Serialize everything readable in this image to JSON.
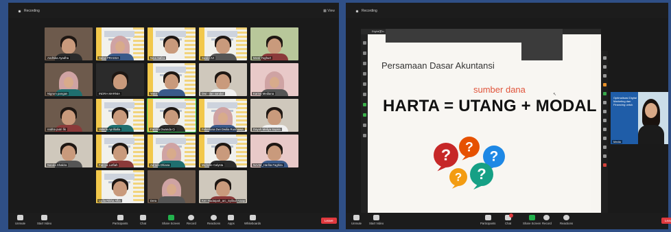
{
  "left_window": {
    "recording_label": "Recording",
    "view_label": "View",
    "participants": [
      {
        "name": "Andhika Ayadha",
        "style": "room"
      },
      {
        "name": "Salsa PRASSA",
        "style": "white"
      },
      {
        "name": "Nina Safira",
        "style": "white"
      },
      {
        "name": "Susilo Art",
        "style": "white"
      },
      {
        "name": "Mesti Yoghurt",
        "style": "green"
      },
      {
        "name": "Nigrum pangan",
        "style": "room"
      },
      {
        "name": "INDRA MARNIA",
        "style": "dark"
      },
      {
        "name": "Yana",
        "style": "white"
      },
      {
        "name": "Dwi - ilan sandal",
        "style": "wall"
      },
      {
        "name": "Karina Mediana",
        "style": "pink"
      },
      {
        "name": "nabha putri fik",
        "style": "room"
      },
      {
        "name": "Valeria Aprilliafia",
        "style": "white"
      },
      {
        "name": "Farizka Dwanda Ci",
        "style": "white"
      },
      {
        "name": "Feberiana Dwi Dwilia Rusmawa",
        "style": "white"
      },
      {
        "name": "Dayuh Meliya Sapira",
        "style": "wall"
      },
      {
        "name": "Nanda Shakira",
        "style": "wall"
      },
      {
        "name": "Fatrina Lutfiah",
        "style": "white"
      },
      {
        "name": "Adrtela Dhiana",
        "style": "white"
      },
      {
        "name": "Michelle Calysta",
        "style": "white"
      },
      {
        "name": "NAAM_Harlita Faghita",
        "style": "pink"
      },
      {
        "name": "Lydia Rikha Aflia",
        "style": "white"
      },
      {
        "name": "Dera",
        "style": "room"
      },
      {
        "name": "Ken Nadaipah_arc_Syifaul Araap",
        "style": "wall"
      }
    ],
    "toolbar": [
      {
        "label": "Unmute",
        "icon": "microphone-muted-icon"
      },
      {
        "label": "Start Video",
        "icon": "video-off-icon"
      },
      {
        "label": "Participants",
        "icon": "participants-icon",
        "count": "26"
      },
      {
        "label": "Chat",
        "icon": "chat-icon"
      },
      {
        "label": "Share Screen",
        "icon": "share-screen-icon"
      },
      {
        "label": "Record",
        "icon": "record-icon"
      },
      {
        "label": "Reactions",
        "icon": "reactions-icon"
      },
      {
        "label": "Apps",
        "icon": "apps-icon"
      },
      {
        "label": "Whiteboards",
        "icon": "whiteboard-icon"
      }
    ],
    "end_label": "Leave"
  },
  "right_window": {
    "recording_label": "Recording",
    "share_title": "Digital Fin",
    "slide": {
      "title": "Persamaan Dasar Akuntansi",
      "annotation": "sumber dana",
      "equation": "HARTA = UTANG + MODAL",
      "question_colors": [
        "#c62828",
        "#e65100",
        "#1e88e5",
        "#f39c12",
        "#16a085"
      ]
    },
    "speaker": {
      "banner_text": "Optimalisasi Digital Marketing dan Financing untuk",
      "name": "Media"
    },
    "toolbar": [
      {
        "label": "Unmute",
        "icon": "microphone-muted-icon"
      },
      {
        "label": "Start Video",
        "icon": "video-off-icon"
      },
      {
        "label": "Participants",
        "icon": "participants-icon",
        "count": "26"
      },
      {
        "label": "Chat",
        "icon": "chat-icon"
      },
      {
        "label": "Share Screen",
        "icon": "share-screen-icon"
      },
      {
        "label": "Record",
        "icon": "record-icon"
      },
      {
        "label": "Reactions",
        "icon": "reactions-icon"
      }
    ],
    "end_label": "Leave"
  },
  "colors": {
    "background": "#2f4f86",
    "window": "#1a1a1a",
    "share_green": "#22b14c",
    "end_red": "#e0393e",
    "annotation_red": "#e0543b"
  }
}
